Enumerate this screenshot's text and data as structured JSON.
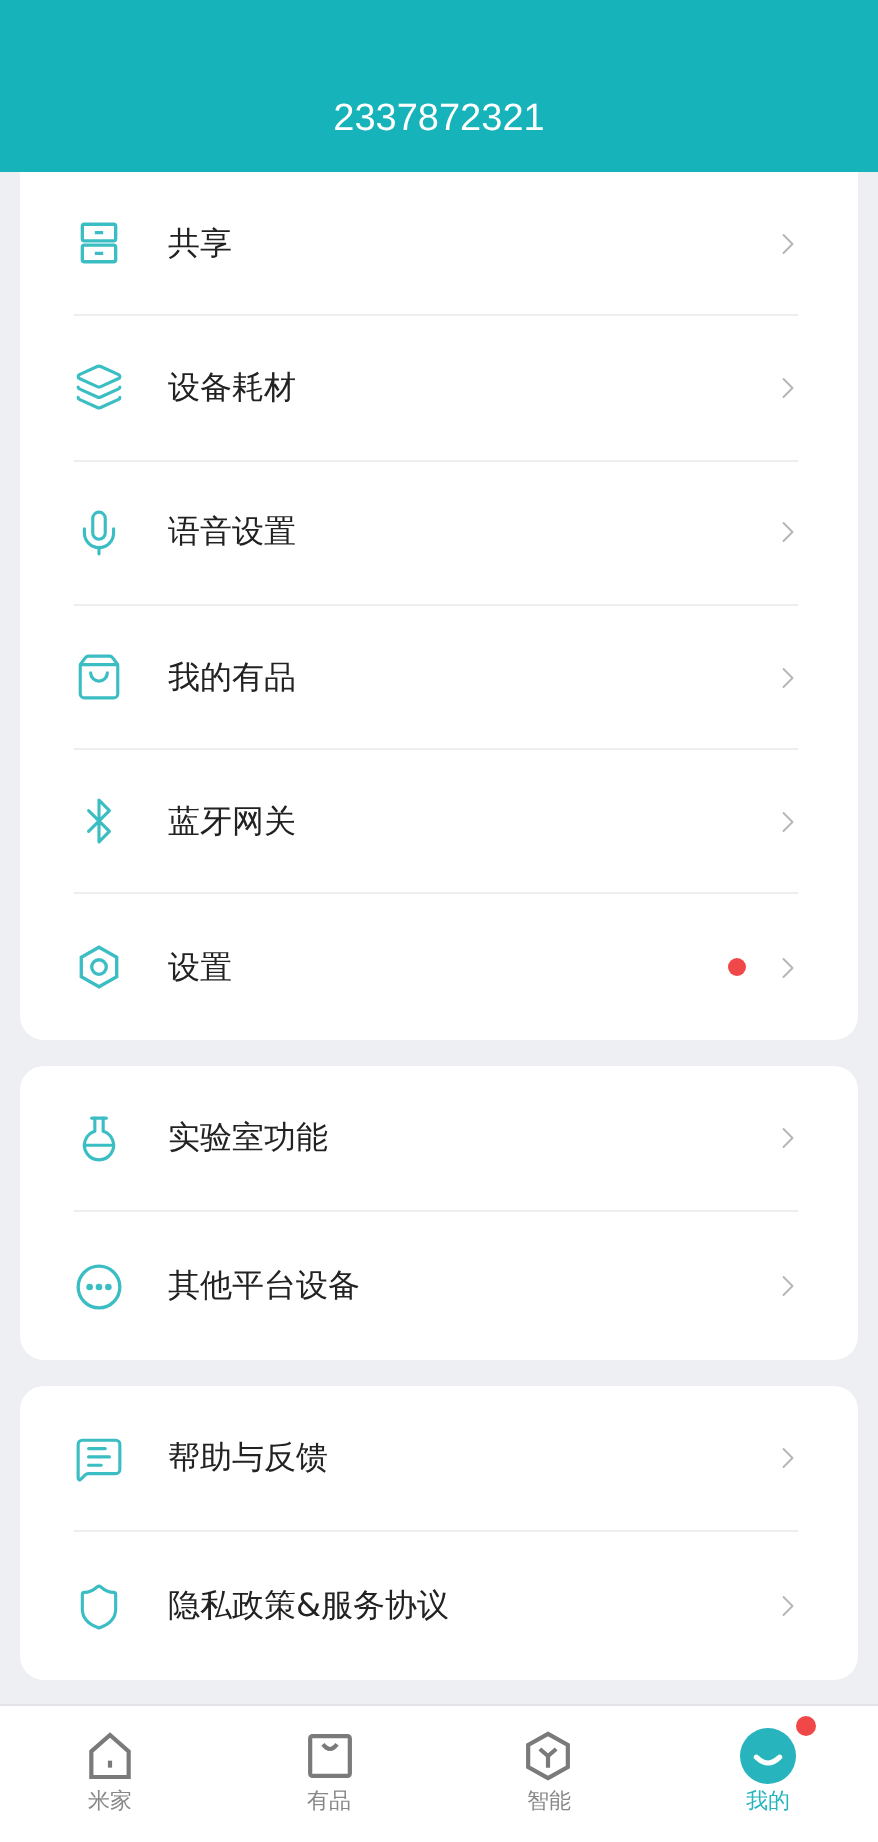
{
  "header": {
    "account": "2337872321"
  },
  "groups": [
    {
      "items": [
        {
          "kind": "share",
          "label": "共享",
          "badge": false
        },
        {
          "kind": "layers",
          "label": "设备耗材",
          "badge": false
        },
        {
          "kind": "mic",
          "label": "语音设置",
          "badge": false
        },
        {
          "kind": "bag",
          "label": "我的有品",
          "badge": false
        },
        {
          "kind": "bluetooth",
          "label": "蓝牙网关",
          "badge": false
        },
        {
          "kind": "settings",
          "label": "设置",
          "badge": true
        }
      ]
    },
    {
      "items": [
        {
          "kind": "flask",
          "label": "实验室功能",
          "badge": false
        },
        {
          "kind": "more",
          "label": "其他平台设备",
          "badge": false
        }
      ]
    },
    {
      "items": [
        {
          "kind": "feedback",
          "label": "帮助与反馈",
          "badge": false
        },
        {
          "kind": "shield",
          "label": "隐私政策&服务协议",
          "badge": false
        }
      ]
    }
  ],
  "tabs": [
    {
      "kind": "home",
      "label": "米家",
      "selected": false,
      "badge": false
    },
    {
      "kind": "store",
      "label": "有品",
      "selected": false,
      "badge": false
    },
    {
      "kind": "smart",
      "label": "智能",
      "selected": false,
      "badge": false
    },
    {
      "kind": "profile",
      "label": "我的",
      "selected": true,
      "badge": true
    }
  ]
}
